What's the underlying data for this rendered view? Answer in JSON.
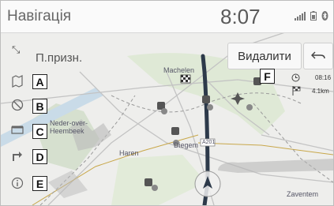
{
  "header": {
    "title": "Навігація",
    "time": "8:07"
  },
  "status_icons": [
    "signal-icon",
    "battery-icon",
    "bluetooth-icon"
  ],
  "toolbar": {
    "destinations_label": "П.призн.",
    "delete_label": "Видалити",
    "back_icon": "back-arrow-icon"
  },
  "callouts": [
    "A",
    "B",
    "C",
    "D",
    "E",
    "F"
  ],
  "side_menu": [
    {
      "icon": "map-route-icon",
      "callout": "A"
    },
    {
      "icon": "no-entry-icon",
      "callout": "B"
    },
    {
      "icon": "checkered-flag-icon",
      "callout": "C"
    },
    {
      "icon": "detour-icon",
      "callout": "D"
    },
    {
      "icon": "info-icon",
      "callout": "E"
    }
  ],
  "route_info": {
    "callout": "F",
    "time": "08:16",
    "distance": "4.1km"
  },
  "map_labels": [
    "Machelen",
    "Neder-over-Heembeek",
    "Diegem",
    "Haren",
    "A201",
    "Zaventem"
  ],
  "colors": {
    "route": "#2d3a4a",
    "map_background": "#f0f0f0",
    "water": "#c9dbe8",
    "green": "#dfe9d6"
  }
}
